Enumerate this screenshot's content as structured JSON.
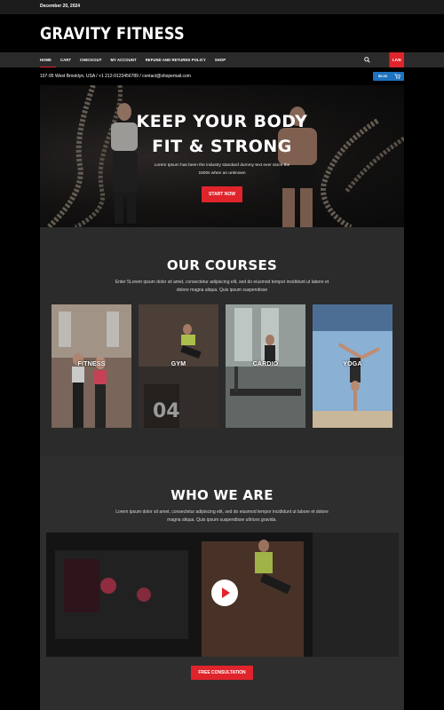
{
  "topbar": {
    "date": "December 20, 2024"
  },
  "brand": {
    "name": "GRAVITY FITNESS"
  },
  "nav": {
    "items": [
      {
        "label": "HOME",
        "active": true
      },
      {
        "label": "CART"
      },
      {
        "label": "CHECKOUT"
      },
      {
        "label": "MY ACCOUNT"
      },
      {
        "label": "REFUND AND RETURNS POLICY"
      },
      {
        "label": "SHOP"
      }
    ],
    "live_label": "LIVE"
  },
  "contact": {
    "text": "107-95 West Brooklyn, USA / +1 212-0123456789  / contact@shopemail.com"
  },
  "cart": {
    "amount": "$0.00"
  },
  "hero": {
    "title_line1": "KEEP YOUR BODY",
    "title_line2": "FIT & STRONG",
    "subtitle": "Lorem Ipsum has been the industry standard dummy text ever since the 1500s when an unknown",
    "cta": "START NOW"
  },
  "courses": {
    "title": "OUR COURSES",
    "text": "Enter 5Lorem ipsum dolor sit amet, consectetur adipiscing elit, sed do eiusmod tempor incididunt ut labore et dolore magna aliqua. Quis ipsum suspendisse",
    "cards": [
      {
        "label": "FITNESS"
      },
      {
        "label": "GYM",
        "number": "04"
      },
      {
        "label": "CARDIO"
      },
      {
        "label": "YOGA"
      }
    ]
  },
  "about": {
    "title": "WHO WE ARE",
    "text": "Lorem ipsum dolor sit amet, consectetur adipiscing elit, sed do eiusmod tempor incididunt ut labore et dolore magna aliqua. Quis ipsum suspendisse ultrices gravida.",
    "cta": "FREE CONSULTATION"
  },
  "colors": {
    "accent": "#e0242b",
    "cart": "#1e73be",
    "dark": "#2b2b2b"
  }
}
